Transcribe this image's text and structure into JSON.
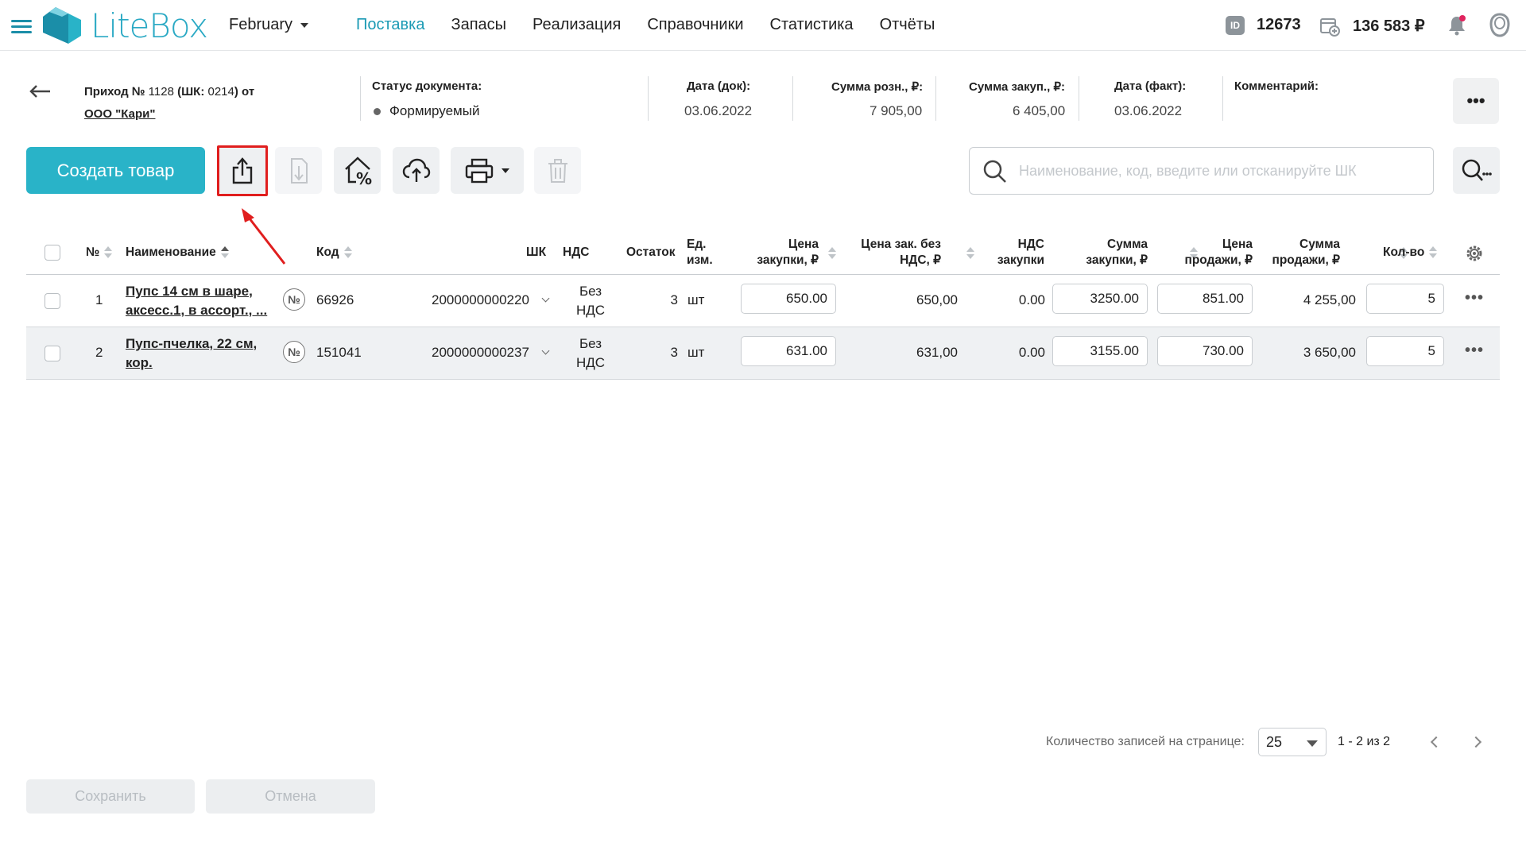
{
  "app": {
    "logo_text": "LiteBox",
    "accent_color": "#29b3c8",
    "month": "February",
    "nav": [
      "Поставка",
      "Запасы",
      "Реализация",
      "Справочники",
      "Статистика",
      "Отчёты"
    ],
    "active_nav": "Поставка",
    "id_badge": "ID",
    "account_id": "12673",
    "balance": "136 583 ₽"
  },
  "document": {
    "title_prefix": "Приход №",
    "title_number": " 1128 ",
    "title_barcode": "(ШК: ",
    "title_barcode_value": "0214",
    "title_suffix": ") от",
    "supplier": "ООО \"Кари\"",
    "status_label": "Статус документа:",
    "status_value": "Формируемый",
    "date_doc_label": "Дата (док):",
    "date_doc_value": "03.06.2022",
    "sum_retail_label": "Сумма розн., ₽:",
    "sum_retail_value": "7 905,00",
    "sum_purchase_label": "Сумма закуп., ₽:",
    "sum_purchase_value": "6 405,00",
    "date_fact_label": "Дата (факт):",
    "date_fact_value": "03.06.2022",
    "comment_label": "Комментарий:",
    "more_label": "•••"
  },
  "toolbar": {
    "create_label": "Создать товар",
    "search_placeholder": "Наименование, код, введите или отсканируйте ШК",
    "icons": [
      "export-icon",
      "import-icon",
      "price-percent-icon",
      "cloud-upload-icon",
      "printer-icon",
      "trash-icon"
    ]
  },
  "table": {
    "headers": {
      "num": "№",
      "name": "Наименование",
      "code": "Код",
      "barcode": "ШК",
      "vat": "НДС",
      "stock": "Остаток",
      "unit_1": "Ед.",
      "unit_2": "изм.",
      "price_purchase_1": "Цена",
      "price_purchase_2": "закупки, ₽",
      "price_no_vat_1": "Цена зак. без",
      "price_no_vat_2": "НДС, ₽",
      "vat_purchase_1": "НДС",
      "vat_purchase_2": "закупки",
      "sum_purchase_1": "Сумма",
      "sum_purchase_2": "закупки, ₽",
      "price_sale_1": "Цена",
      "price_sale_2": "продажи, ₽",
      "sum_sale_1": "Сумма",
      "sum_sale_2": "продажи, ₽",
      "qty": "Кол-во"
    },
    "rows": [
      {
        "num": "1",
        "name_1": "Пупс 14 см в шаре,",
        "name_2": "аксесс.1, в ассорт., ...",
        "no_badge": "№",
        "code": "66926",
        "barcode": "2000000000220",
        "vat_1": "Без",
        "vat_2": "НДС",
        "stock": "3",
        "unit": "шт",
        "price_purchase": "650.00",
        "price_no_vat": "650,00",
        "vat_purchase": "0.00",
        "sum_purchase": "3250.00",
        "price_sale": "851.00",
        "sum_sale": "4 255,00",
        "qty": "5"
      },
      {
        "num": "2",
        "name_1": "Пупс-пчелка, 22 см,",
        "name_2": "кор.",
        "no_badge": "№",
        "code": "151041",
        "barcode": "2000000000237",
        "vat_1": "Без",
        "vat_2": "НДС",
        "stock": "3",
        "unit": "шт",
        "price_purchase": "631.00",
        "price_no_vat": "631,00",
        "vat_purchase": "0.00",
        "sum_purchase": "3155.00",
        "price_sale": "730.00",
        "sum_sale": "3 650,00",
        "qty": "5"
      }
    ]
  },
  "pagination": {
    "per_page_label": "Количество записей на странице:",
    "per_page_value": "25",
    "range": "1 - 2 из 2"
  },
  "footer": {
    "save_label": "Сохранить",
    "cancel_label": "Отмена"
  }
}
